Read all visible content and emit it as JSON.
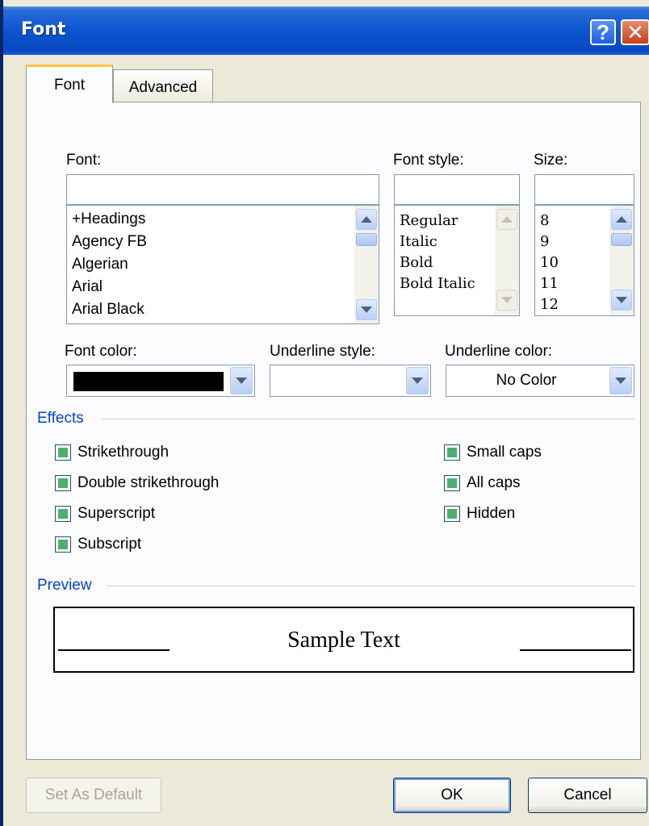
{
  "window": {
    "title": "Font",
    "help_glyph": "?",
    "close_glyph": "✕"
  },
  "tabs": [
    {
      "label": "Font",
      "mnemonic": "n"
    },
    {
      "label": "Advanced",
      "mnemonic": "v"
    }
  ],
  "font": {
    "label": "Font:",
    "value": "",
    "items": [
      "+Headings",
      "Agency FB",
      "Algerian",
      "Arial",
      "Arial Black"
    ]
  },
  "font_style": {
    "label": "Font style:",
    "value": "",
    "items": [
      "Regular",
      "Italic",
      "Bold",
      "Bold Italic"
    ]
  },
  "size": {
    "label": "Size:",
    "value": "",
    "items": [
      "8",
      "9",
      "10",
      "11",
      "12"
    ]
  },
  "font_color": {
    "label": "Font color:",
    "swatch": "#000000"
  },
  "underline_style": {
    "label": "Underline style:",
    "value": ""
  },
  "underline_color": {
    "label": "Underline color:",
    "value": "No Color"
  },
  "effects": {
    "title": "Effects",
    "left": [
      "Strikethrough",
      "Double strikethrough",
      "Superscript",
      "Subscript"
    ],
    "right": [
      "Small caps",
      "All caps",
      "Hidden"
    ],
    "state": "indeterminate"
  },
  "preview": {
    "title": "Preview",
    "sample_text": "Sample Text"
  },
  "buttons": {
    "set_default": "Set As Default",
    "ok": "OK",
    "cancel": "Cancel"
  },
  "colors": {
    "title_bar": "#0c55d0",
    "group_title": "#0046d5",
    "check_fill": "#4caf6e",
    "tab_highlight": "#ffc83c"
  }
}
